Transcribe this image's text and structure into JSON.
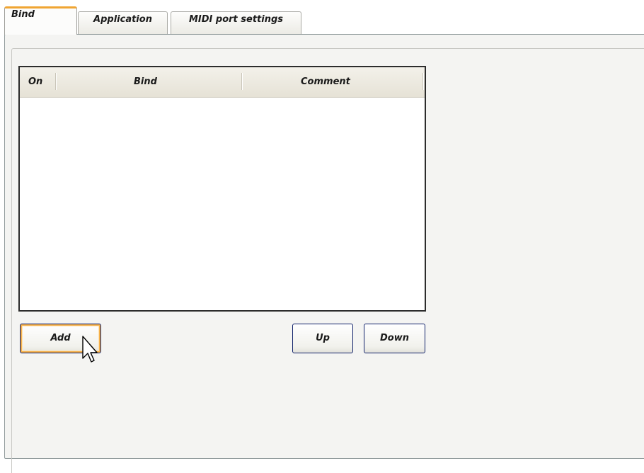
{
  "tabs": [
    {
      "label": "Bind",
      "active": true
    },
    {
      "label": "Application",
      "active": false
    },
    {
      "label": "MIDI port settings",
      "active": false
    }
  ],
  "bind_list": {
    "columns": [
      "On",
      "Bind",
      "Comment"
    ],
    "rows": []
  },
  "buttons": {
    "add": "Add",
    "up": "Up",
    "down": "Down"
  },
  "colors": {
    "active_tab_accent": "#f0a533",
    "button_focus": "#f5b04a",
    "button_border": "#11226b",
    "panel_background": "#f4f4f2"
  },
  "cursor_icon": "arrow-pointer"
}
